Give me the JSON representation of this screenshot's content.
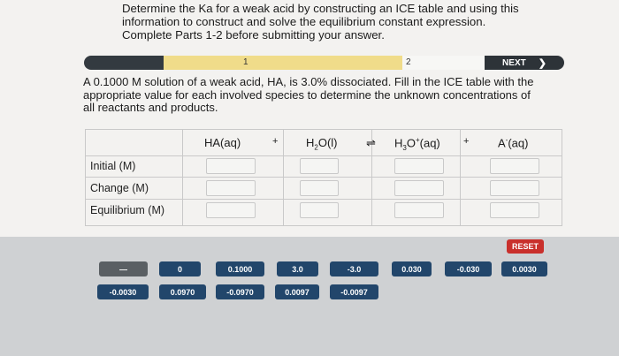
{
  "instructions": "Determine the Ka for a weak acid by constructing an ICE table and using this information to construct and solve the equilibrium constant expression. Complete Parts 1-2 before submitting your answer.",
  "progress": {
    "step1": "1",
    "step2": "2",
    "next_label": "NEXT",
    "next_icon": "chevron-right-icon",
    "colors": {
      "bar": "#333a40",
      "current": "#f0dc8a",
      "next": "#f7f7f5"
    }
  },
  "question": "A 0.1000 M solution of a weak acid, HA, is 3.0% dissociated. Fill in the ICE table with the appropriate value for each involved species to determine the unknown concentrations of all reactants and products.",
  "ice_table": {
    "headers": [
      "HA(aq)",
      "+",
      "H2O(l)",
      "⇌",
      "H3O+(aq)",
      "+",
      "A-(aq)"
    ],
    "rows": [
      "Initial (M)",
      "Change (M)",
      "Equilibrium (M)"
    ]
  },
  "reset_label": "RESET",
  "tiles": {
    "row1": [
      "—",
      "0",
      "0.1000",
      "3.0",
      "-3.0",
      "0.030",
      "-0.030",
      "0.0030"
    ],
    "row2": [
      "-0.0030",
      "0.0970",
      "-0.0970",
      "0.0097",
      "-0.0097"
    ]
  },
  "colors": {
    "tile": "#22466b",
    "reset": "#c9302c",
    "background": "#f3f2f0",
    "band": "#cfd1d3"
  }
}
